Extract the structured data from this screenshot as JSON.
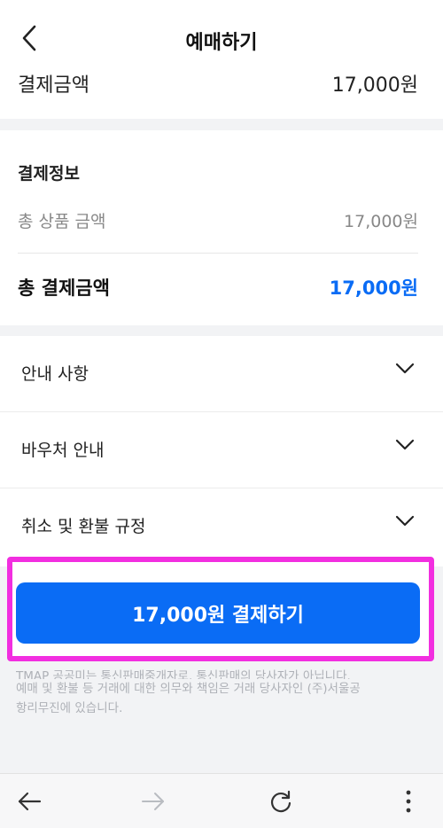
{
  "header": {
    "title": "예매하기"
  },
  "top_summary": {
    "label": "결제금액",
    "value": "17,000원"
  },
  "payment_info": {
    "section_title": "결제정보",
    "subtotal_label": "총 상품 금액",
    "subtotal_value": "17,000원",
    "total_label": "총 결제금액",
    "total_value": "17,000원",
    "total_color": "#0a6cf5"
  },
  "info_items": [
    {
      "label": "안내 사항"
    },
    {
      "label": "바우처 안내"
    },
    {
      "label": "취소 및 환불 규정"
    }
  ],
  "pay_button": {
    "label": "17,000원 결제하기",
    "color": "#0a6cf5"
  },
  "notice": {
    "line1": "TMAP 공공미는 통신판매중개자로, 통신판매의 당사자가 아닙니다.",
    "line2": "예매 및 환불 등 거래에 대한 의무와 책임은 거래 당사자인 (주)서울공",
    "line3": "항리무진에 있습니다."
  },
  "highlight_color": "#f22ee0",
  "bottom_nav": {
    "icons": [
      "back-arrow-icon",
      "forward-arrow-icon",
      "refresh-icon",
      "more-vertical-icon"
    ]
  }
}
